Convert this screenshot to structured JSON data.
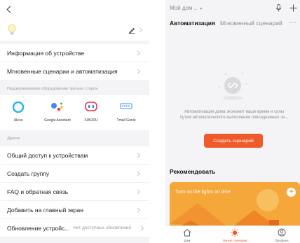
{
  "left_panel": {
    "edit_icon": "pencil-icon",
    "device_icon": "light-bulb-icon",
    "items_top": [
      {
        "label": "Информация об устройстве"
      },
      {
        "label": "Мгновенные сценарии и автоматизация"
      }
    ],
    "third_party_section": "Поддерживаемое оборудование третьих сторон",
    "brands": [
      {
        "name": "Alexa",
        "icon": "alexa-icon",
        "color": "#2bb7ea"
      },
      {
        "name": "Google Assistant",
        "icon": "google-assistant-icon",
        "color": "#4285f4"
      },
      {
        "name": "XIAODU",
        "icon": "xiaodu-icon",
        "color": "#e8354a"
      },
      {
        "name": "Tmall Genie",
        "icon": "tmall-genie-icon",
        "color": "#3f8cff"
      }
    ],
    "other_section": "Другое",
    "items_other": [
      {
        "label": "Общий доступ к устройствам"
      },
      {
        "label": "Создать группу"
      },
      {
        "label": "FAQ и обратная связь"
      },
      {
        "label": "Добавить на главный экран"
      },
      {
        "label": "Обновление устройс...",
        "hint": "Нет доступных обновлений"
      }
    ]
  },
  "right_panel": {
    "home_selector": "Мой дом ..",
    "mic_icon": "microphone-icon",
    "add_icon": "plus-icon",
    "tabs": {
      "active": "Автоматизация",
      "inactive": "Мгновенный сценарий",
      "more": "···"
    },
    "empty_icon": "automation-loop-icon",
    "empty_text_line1": "Автоматизация дома экономит ваше время и силы",
    "empty_text_line2": "путем автоматического выполнения повседневных за...",
    "create_button": "Создать сценарий",
    "recommend_title": "Рекомендовать",
    "card_title": "Turn on the lights on time",
    "card_add": "+",
    "tabbar": [
      {
        "label": "Дом",
        "icon": "home-icon",
        "active": false
      },
      {
        "label": "Умные сценарии",
        "icon": "smart-scene-icon",
        "active": true
      },
      {
        "label": "Профиль",
        "icon": "profile-icon",
        "active": false
      }
    ]
  },
  "colors": {
    "accent": "#ef5a2a",
    "card": "#f5a73a",
    "background": "#f4f4f6"
  }
}
